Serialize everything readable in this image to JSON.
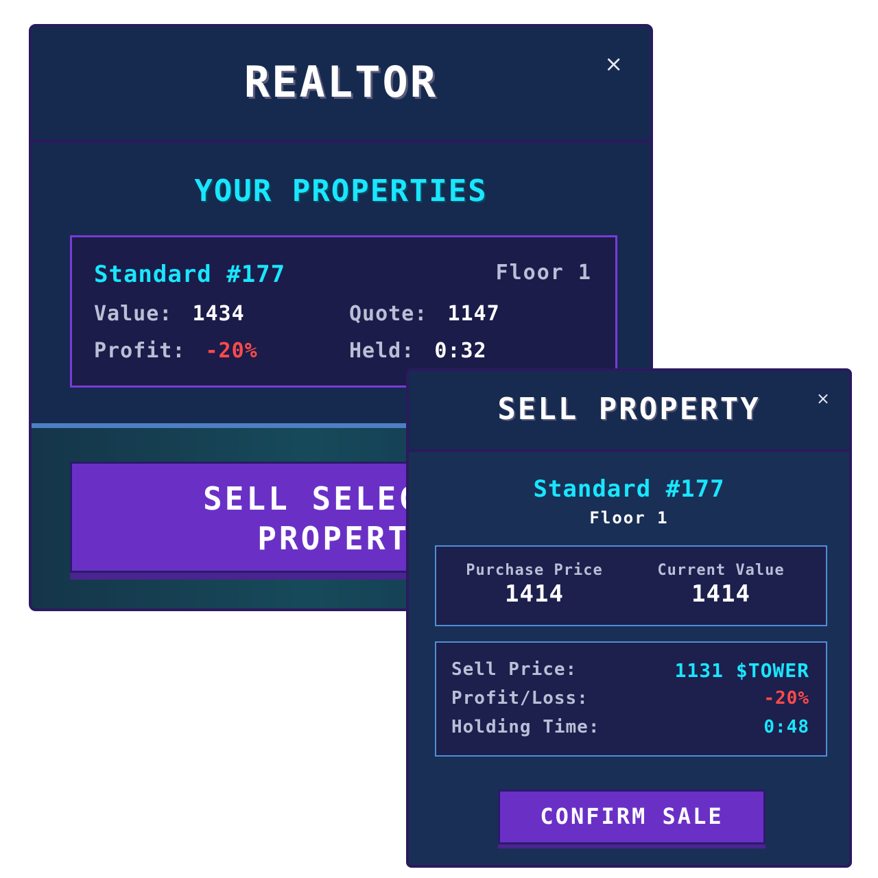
{
  "realtor": {
    "title": "REALTOR",
    "close": "×",
    "subtitle": "YOUR PROPERTIES",
    "property": {
      "name": "Standard #177",
      "floor": "Floor 1",
      "value_label": "Value:",
      "value": "1434",
      "quote_label": "Quote:",
      "quote": "1147",
      "profit_label": "Profit:",
      "profit": "-20%",
      "held_label": "Held:",
      "held": "0:32"
    },
    "sell_button_line1": "SELL SELECTED",
    "sell_button_line2": "PROPERTY"
  },
  "sell_modal": {
    "title": "SELL PROPERTY",
    "close": "×",
    "property_name": "Standard #177",
    "floor": "Floor 1",
    "purchase_price_label": "Purchase Price",
    "purchase_price": "1414",
    "current_value_label": "Current Value",
    "current_value": "1414",
    "sell_price_label": "Sell Price:",
    "sell_price": "1131 $TOWER",
    "profit_loss_label": "Profit/Loss:",
    "profit_loss": "-20%",
    "holding_time_label": "Holding Time:",
    "holding_time": "0:48",
    "confirm_label": "CONFIRM SALE"
  },
  "colors": {
    "panel_bg": "#162a4f",
    "accent_cyan": "#19e6ff",
    "accent_purple": "#6a30c6",
    "negative_red": "#ff4b4b"
  }
}
